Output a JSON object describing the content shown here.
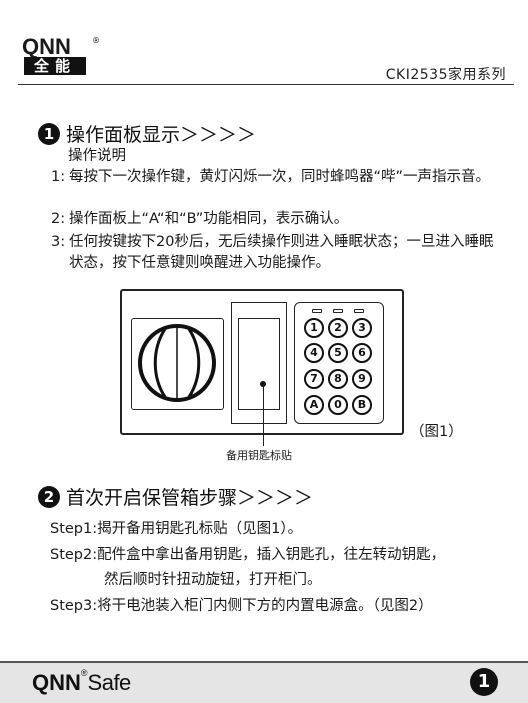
{
  "header": {
    "logo_text": "QNN",
    "logo_reg": "®",
    "logo_cn": "全能",
    "series": "CKI2535家用系列"
  },
  "section1": {
    "badge": "1",
    "title": "操作面板显示＞＞＞＞",
    "subtitle": "操作说明",
    "items": [
      {
        "num": "1:",
        "text": "每按下一次操作键，黄灯闪烁一次，同时蜂鸣器“哔”一声指示音。"
      },
      {
        "num": "2:",
        "text": "操作面板上“A“和“B”功能相同，表示确认。"
      },
      {
        "num": "3:",
        "text": "任何按键按下20秒后，无后续操作则进入睡眠状态；一旦进入睡眠状态，按下任意键则唤醒进入功能操作。"
      }
    ]
  },
  "figure1": {
    "keys": [
      [
        "1",
        "2",
        "3"
      ],
      [
        "4",
        "5",
        "6"
      ],
      [
        "7",
        "8",
        "9"
      ],
      [
        "A",
        "0",
        "B"
      ]
    ],
    "sticker_label": "备用钥匙标贴",
    "caption": "（图1）"
  },
  "section2": {
    "badge": "2",
    "title": "首次开启保管箱步骤＞＞＞＞",
    "steps": [
      "Step1:揭开备用钥匙孔标贴（见图1）。",
      "Step2:配件盒中拿出备用钥匙，插入钥匙孔，往左转动钥匙，",
      "然后顺时针扭动旋钮，打开柜门。",
      "Step3:将干电池装入柜门内侧下方的内置电源盒。（见图2）"
    ]
  },
  "footer": {
    "brand": "QNN",
    "reg": "®",
    "safe": "Safe",
    "page": "1"
  }
}
